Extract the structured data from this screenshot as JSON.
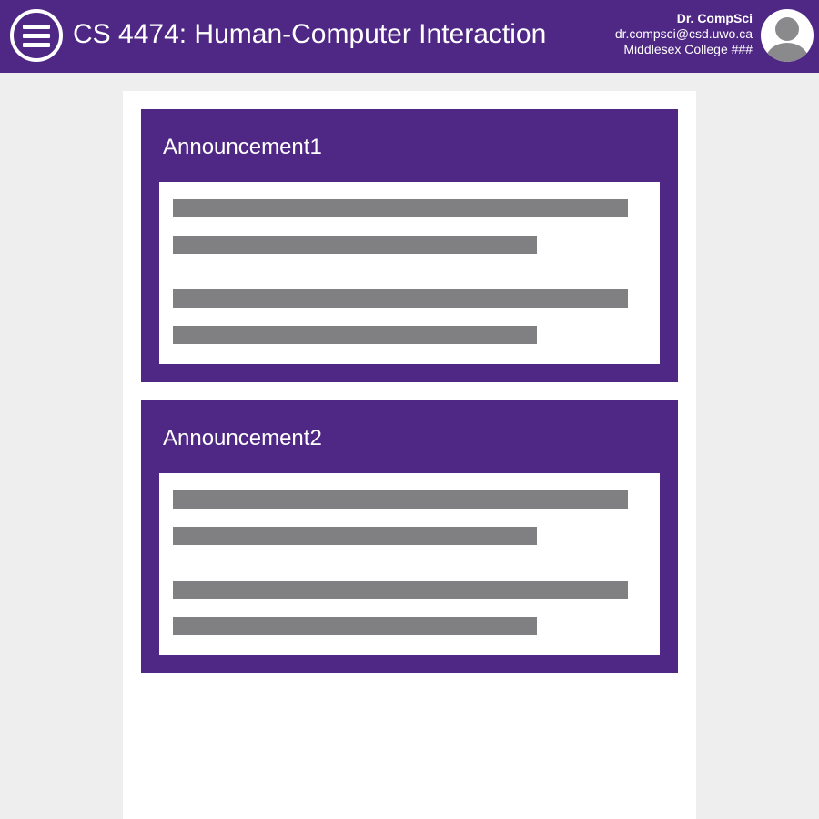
{
  "header": {
    "menu_icon": "hamburger-menu-icon",
    "course_title": "CS 4474: Human-Computer Interaction",
    "user": {
      "name": "Dr. CompSci",
      "email": "dr.compsci@csd.uwo.ca",
      "office": "Middlesex College ###",
      "avatar_icon": "user-avatar-icon"
    }
  },
  "announcements": [
    {
      "title": "Announcement1"
    },
    {
      "title": "Announcement2"
    }
  ],
  "colors": {
    "brand_purple": "#4f2784",
    "background": "#eeeeee",
    "placeholder_text_gray": "#808083",
    "white": "#ffffff"
  }
}
